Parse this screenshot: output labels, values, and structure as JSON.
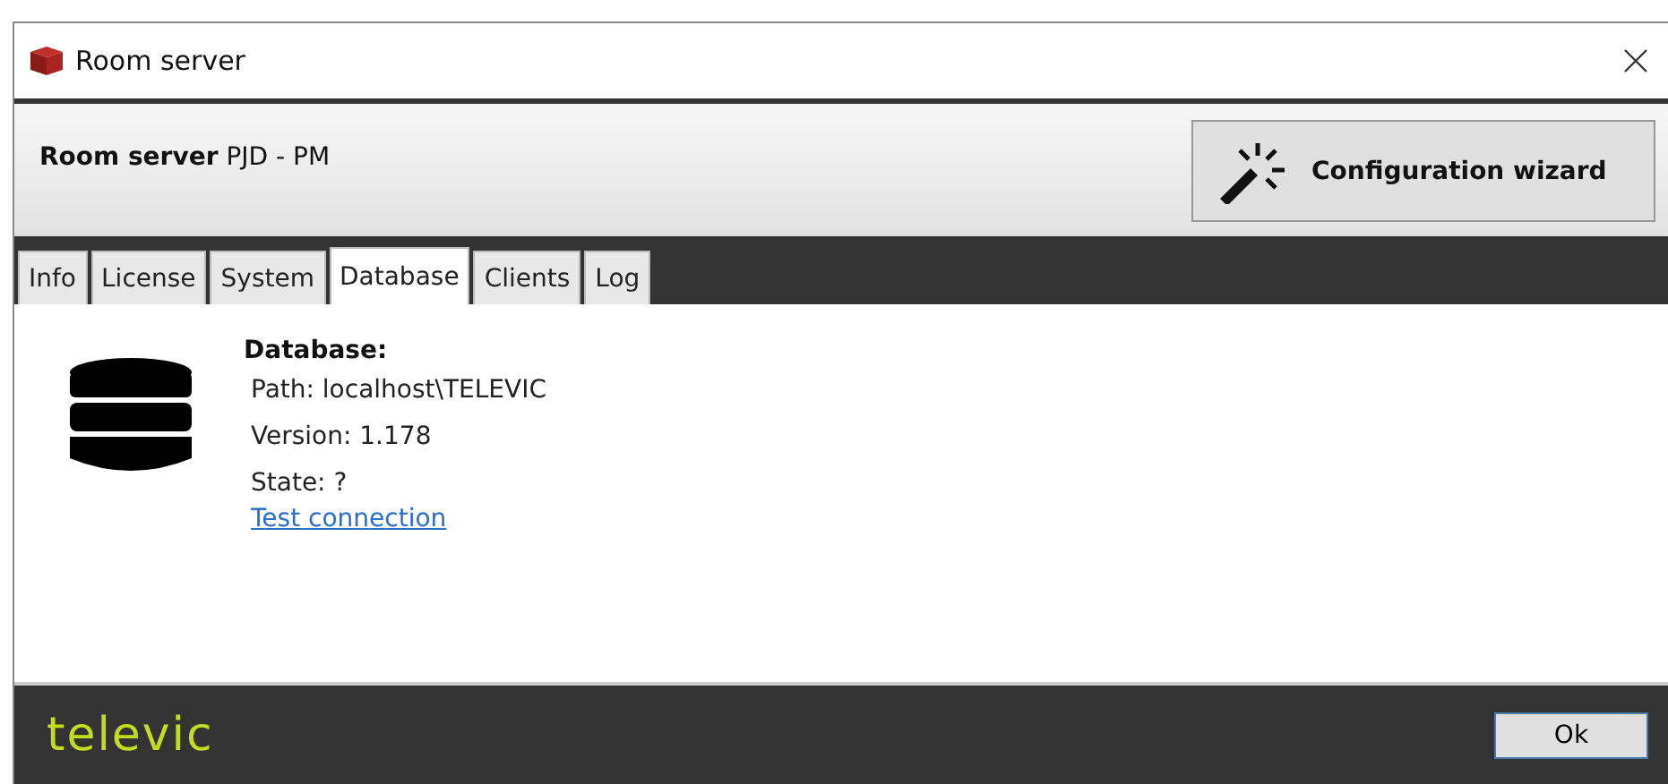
{
  "window": {
    "title": "Room server"
  },
  "header": {
    "title": "**Room server** PJD - PM",
    "wizard_button": "Configuration wizard"
  },
  "tabs": [
    {
      "label": "Info",
      "selected": false
    },
    {
      "label": "License",
      "selected": false
    },
    {
      "label": "System",
      "selected": false
    },
    {
      "label": "Database",
      "selected": true
    },
    {
      "label": "Clients",
      "selected": false
    },
    {
      "label": "Log",
      "selected": false
    }
  ],
  "database": {
    "heading": "Database:",
    "lines": [
      "Path: localhost\\TELEVIC",
      "Version: 1.178",
      "State: ?"
    ],
    "link": "Test connection"
  },
  "footer": {
    "logo": "televic",
    "ok_button": "Ok"
  }
}
